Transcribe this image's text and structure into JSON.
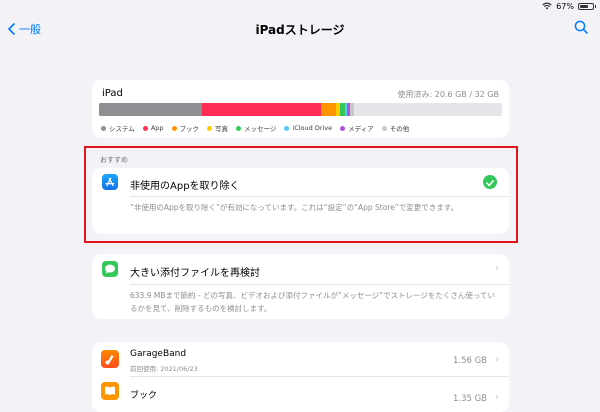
{
  "status": {
    "battery": "67%",
    "battery_level": 0.67
  },
  "nav": {
    "back_label": "一般",
    "title": "iPadストレージ"
  },
  "storage": {
    "device": "iPad",
    "used_text": "使用済み: 20.6 GB / 32 GB",
    "segments": [
      {
        "category": "システム",
        "fraction": 0.256,
        "color": "#8e8e93"
      },
      {
        "category": "App",
        "fraction": 0.295,
        "color": "#ff2d55"
      },
      {
        "category": "ブック",
        "fraction": 0.036,
        "color": "#ff9500"
      },
      {
        "category": "写真",
        "fraction": 0.012,
        "color": "#ffcc00"
      },
      {
        "category": "メッセージ",
        "fraction": 0.012,
        "color": "#34c759"
      },
      {
        "category": "iCloud Drive",
        "fraction": 0.004,
        "color": "#5ac8fa"
      },
      {
        "category": "メディア",
        "fraction": 0.008,
        "color": "#af52de"
      },
      {
        "category": "その他",
        "fraction": 0.01,
        "color": "#c7c7cc"
      }
    ],
    "legend": [
      {
        "label": "システム",
        "color": "#8e8e93"
      },
      {
        "label": "App",
        "color": "#ff2d55"
      },
      {
        "label": "ブック",
        "color": "#ff9500"
      },
      {
        "label": "写真",
        "color": "#ffcc00"
      },
      {
        "label": "メッセージ",
        "color": "#34c759"
      },
      {
        "label": "iCloud Drive",
        "color": "#5ac8fa"
      },
      {
        "label": "メディア",
        "color": "#af52de"
      },
      {
        "label": "その他",
        "color": "#c7c7cc"
      }
    ]
  },
  "recommendations": {
    "header": "おすすめ",
    "offload": {
      "title": "非使用のAppを取り除く",
      "desc": "“非使用のAppを取り除く”が有効になっています。これは“設定”の“App Store”で変更できます。"
    },
    "attachments": {
      "title": "大きい添付ファイルを再検討",
      "desc": "633.9 MBまで節約 - どの写真、ビデオおよび添付ファイルが“メッセージ”でストレージをたくさん使っているかを見て、削除するものを検討します。"
    }
  },
  "apps": [
    {
      "name": "GarageBand",
      "subtitle": "前回使用: 2021/06/23",
      "size": "1.56 GB"
    },
    {
      "name": "ブック",
      "subtitle": "",
      "size": "1.35 GB"
    }
  ],
  "highlight_color": "#e0161d"
}
